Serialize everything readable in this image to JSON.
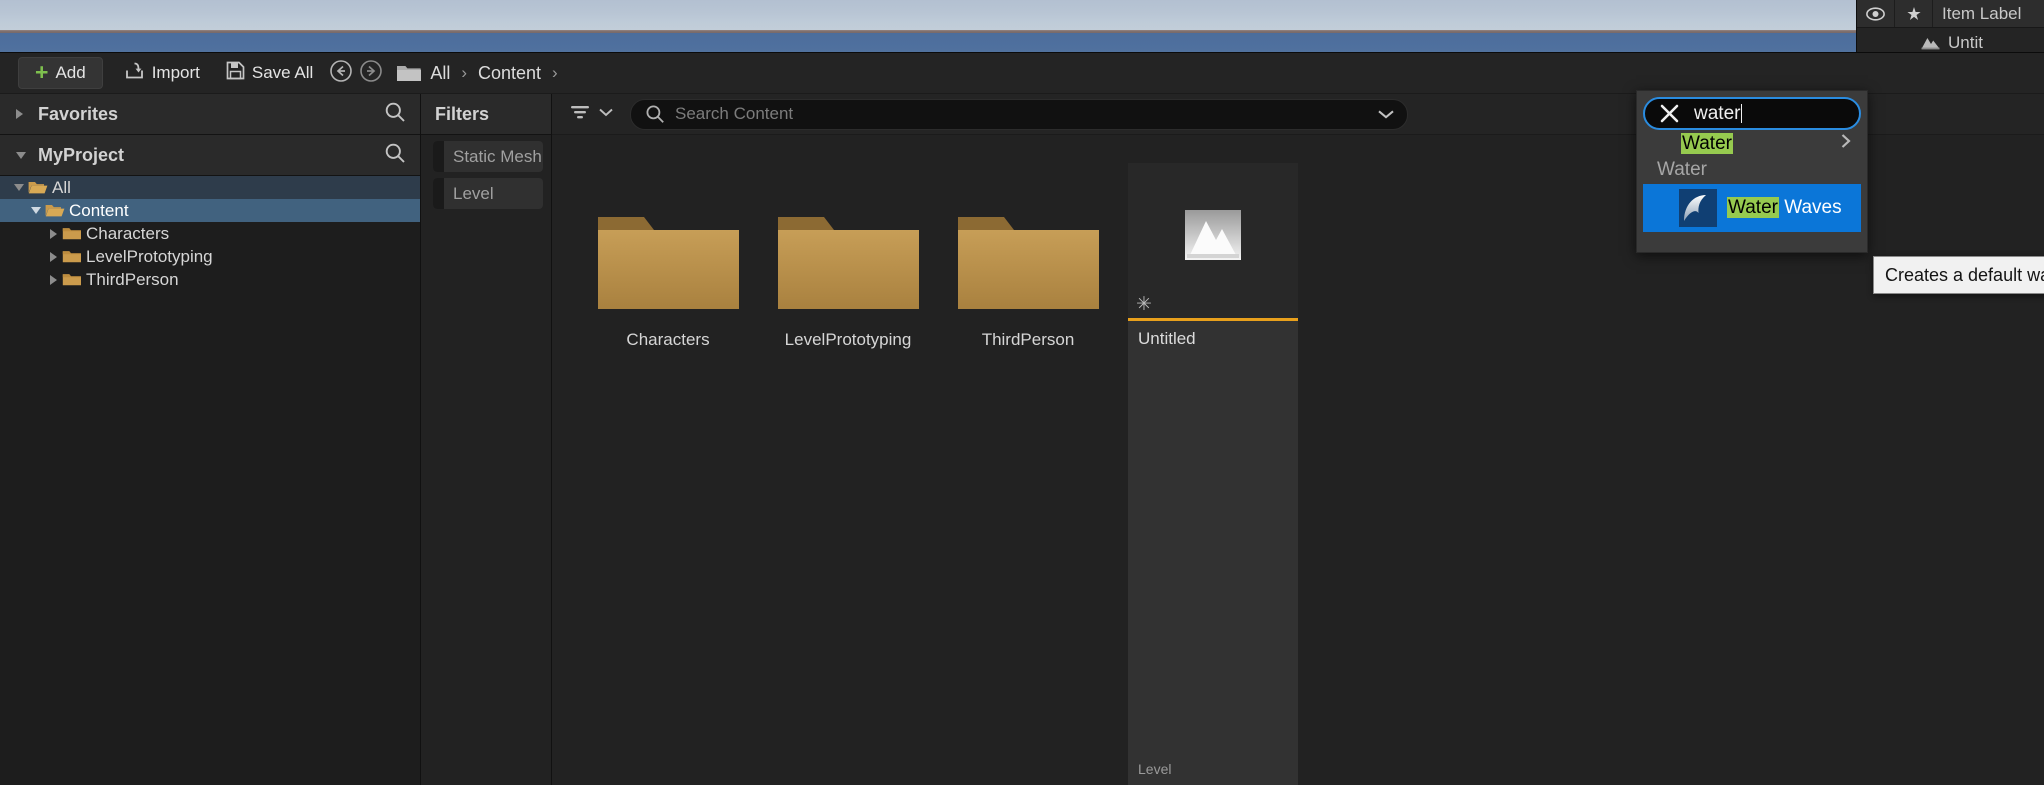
{
  "outliner": {
    "columns": {
      "visibility_icon": "eye-icon",
      "pin_icon": "pin-icon",
      "item_label": "Item Label"
    },
    "rows": [
      {
        "icon": "level-icon",
        "name": "Untit"
      }
    ]
  },
  "content_browser": {
    "toolbar": {
      "add_label": "Add",
      "add_icon": "plus-icon",
      "import_label": "Import",
      "import_icon": "import-icon",
      "save_all_label": "Save All",
      "save_all_icon": "save-icon",
      "back_icon": "arrow-left-circle-icon",
      "forward_icon": "arrow-right-circle-icon",
      "path_folder_icon": "folder-icon",
      "breadcrumbs": [
        {
          "label": "All"
        },
        {
          "label": "Content"
        }
      ],
      "separator": "›"
    },
    "sources": {
      "favorites": {
        "label": "Favorites",
        "search_icon": "search-icon",
        "expanded": false
      },
      "project": {
        "label": "MyProject",
        "search_icon": "search-icon",
        "expanded": true
      },
      "tree": [
        {
          "label": "All",
          "depth": 0,
          "expanded": true,
          "state": "hover"
        },
        {
          "label": "Content",
          "depth": 1,
          "expanded": true,
          "state": "selected"
        },
        {
          "label": "Characters",
          "depth": 2,
          "expanded": false,
          "state": "normal"
        },
        {
          "label": "LevelPrototyping",
          "depth": 2,
          "expanded": false,
          "state": "normal"
        },
        {
          "label": "ThirdPerson",
          "depth": 2,
          "expanded": false,
          "state": "normal"
        }
      ]
    },
    "filters": {
      "title": "Filters",
      "items": [
        {
          "label": "Static Mesh"
        },
        {
          "label": "Level"
        }
      ]
    },
    "assets_view": {
      "filter_button_icon": "filter-funnel-icon",
      "filter_dropdown_icon": "chevron-down-icon",
      "search": {
        "icon": "search-icon",
        "placeholder": "Search Content",
        "value": "",
        "dropdown_icon": "chevron-down-icon"
      },
      "folders": [
        {
          "label": "Characters",
          "icon": "folder-icon"
        },
        {
          "label": "LevelPrototyping",
          "icon": "folder-icon"
        },
        {
          "label": "ThirdPerson",
          "icon": "folder-icon"
        }
      ],
      "assets": [
        {
          "name": "Untitled",
          "type": "Level",
          "thumbnail_icon": "level-thumbnail-icon",
          "modified_icon": "asterisk-icon",
          "accent_color": "#e8a01c"
        }
      ]
    }
  },
  "place_actors_popup": {
    "search": {
      "clear_icon": "close-x-icon",
      "value": "water",
      "cursor_visible": true
    },
    "category": {
      "label_highlight": "Water",
      "label_rest": "",
      "expand_icon": "chevron-right-icon"
    },
    "section_header": "Water",
    "results": [
      {
        "icon": "water-waves-icon",
        "name_highlight": "Water",
        "name_rest": " Waves",
        "selected": true
      }
    ],
    "highlight_color": "#96ca4f",
    "selection_color": "#0b76d8",
    "focus_border_color": "#2a8ce0"
  },
  "tooltip": {
    "text": "Creates a default wa"
  }
}
